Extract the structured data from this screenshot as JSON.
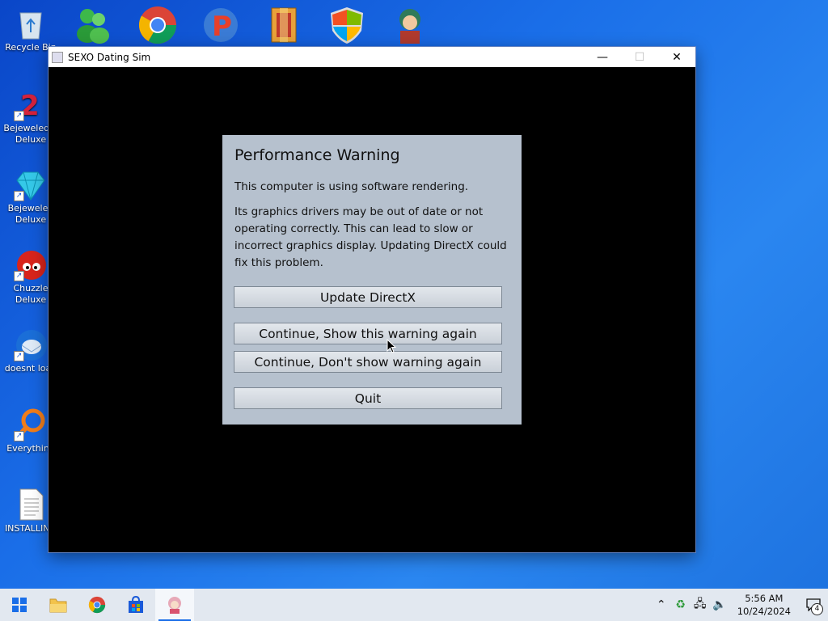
{
  "desktop": {
    "icons": [
      {
        "label": "Recycle Bin",
        "icon": "recycle-bin-icon"
      },
      {
        "label": "Bejeweled 2 Deluxe",
        "icon": "bejeweled-2-icon"
      },
      {
        "label": "Bejeweled Deluxe",
        "icon": "bejeweled-icon"
      },
      {
        "label": "Chuzzle Deluxe",
        "icon": "chuzzle-icon"
      },
      {
        "label": "doesnt load",
        "icon": "thunderbird-icon"
      },
      {
        "label": "Everything",
        "icon": "everything-search-icon"
      },
      {
        "label": "INSTALLING",
        "icon": "text-file-icon"
      }
    ],
    "top_icons": [
      "messenger-icon",
      "chrome-icon",
      "ppsspp-icon",
      "winrar-icon",
      "windows-defender-icon",
      "game-character-icon"
    ]
  },
  "window": {
    "title": "SEXO Dating Sim",
    "minimize": "—",
    "maximize": "☐",
    "close": "✕"
  },
  "dialog": {
    "title": "Performance Warning",
    "line1": "This computer is using software rendering.",
    "line2": "Its graphics drivers may be out of date or not operating correctly. This can lead to slow or incorrect graphics display. Updating DirectX could fix this problem.",
    "buttons": {
      "update": "Update DirectX",
      "continue_show": "Continue, Show this warning again",
      "continue_dont": "Continue, Don't show warning again",
      "quit": "Quit"
    }
  },
  "taskbar": {
    "time": "5:56 AM",
    "date": "10/24/2024",
    "notification_count": "4"
  }
}
